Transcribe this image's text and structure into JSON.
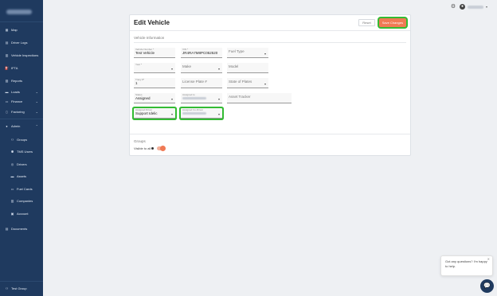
{
  "sidebar": {
    "items": [
      {
        "label": "Map",
        "icon": "map-icon"
      },
      {
        "label": "Driver Logs",
        "icon": "book-icon"
      },
      {
        "label": "Vehicle Inspections",
        "icon": "clipboard-icon"
      },
      {
        "label": "IFTA",
        "icon": "fuel-icon"
      },
      {
        "label": "Reports",
        "icon": "report-icon"
      },
      {
        "label": "Loads",
        "icon": "truck-icon"
      },
      {
        "label": "Finance",
        "icon": "wallet-icon"
      },
      {
        "label": "Factoring",
        "icon": "bank-icon"
      },
      {
        "label": "Admin",
        "icon": "gear-icon"
      },
      {
        "label": "Groups",
        "icon": "group-icon"
      },
      {
        "label": "TMS Users",
        "icon": "user-icon"
      },
      {
        "label": "Drivers",
        "icon": "steering-icon"
      },
      {
        "label": "Assets",
        "icon": "truck-icon"
      },
      {
        "label": "Fuel Cards",
        "icon": "card-icon"
      },
      {
        "label": "Companies",
        "icon": "building-icon"
      },
      {
        "label": "Account",
        "icon": "account-icon"
      },
      {
        "label": "Documents",
        "icon": "document-icon"
      }
    ],
    "footer": {
      "label": "Test Group"
    }
  },
  "header": {
    "settings_icon": "gear-icon",
    "avatar_icon": "person-icon"
  },
  "page": {
    "title": "Edit Vehicle",
    "reset_label": "Reset",
    "save_label": "Save Changes",
    "section_title": "Vehicle Information",
    "groups_title": "Groups",
    "visible_to_all_label": "Visible to all",
    "visible_to_all": true
  },
  "fields": {
    "vehicle_number": {
      "label": "Vehicle Number *",
      "value": "Test Vehicle"
    },
    "vin": {
      "label": "VIN *",
      "value": "JR4RA7M8PC052520"
    },
    "fuel_type": {
      "label": "",
      "placeholder": "Fuel Type"
    },
    "year": {
      "label": "Year *",
      "value": ""
    },
    "make": {
      "label": "",
      "placeholder": "Make"
    },
    "model": {
      "label": "",
      "placeholder": "Model"
    },
    "tracy": {
      "label": "Tracy #*",
      "value": "1"
    },
    "license_plate": {
      "label": "",
      "placeholder": "License Plate #"
    },
    "state_of_plates": {
      "label": "",
      "placeholder": "State of Plates"
    },
    "status": {
      "label": "Status",
      "value": "Assigned"
    },
    "assigned_to": {
      "label": "Assigned to",
      "value": ""
    },
    "asset_tracker": {
      "label": "",
      "placeholder": "Asset Tracker"
    },
    "assigned_driver": {
      "label": "Assigned Driver",
      "value": "Support Idelic"
    },
    "assigned_co_driver": {
      "label": "Assigned Co-Driver",
      "value": ""
    }
  },
  "chat": {
    "message": "Got any questions? I'm happy to help.",
    "close_icon": "close-icon",
    "launcher_icon": "chat-icon"
  },
  "colors": {
    "sidebar": "#1f3a5f",
    "accent": "#f07a55",
    "highlight": "#33bb33"
  }
}
